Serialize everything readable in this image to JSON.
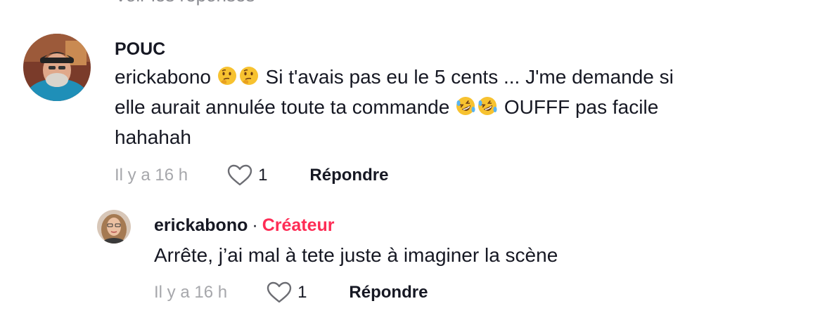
{
  "cutoff_text": "Voir les réponses",
  "comments": [
    {
      "username": "POUC",
      "text_parts": {
        "mention": "erickabono",
        "a": "Si t'avais pas eu le 5 cents ... J'me demande si",
        "b": "elle aurait annulée toute ta commande",
        "c": "OUFFF pas facile",
        "d": "hahahah"
      },
      "emojis": [
        "thinking-face",
        "thinking-face",
        "rolling-laughing-face",
        "rolling-laughing-face"
      ],
      "time": "Il y a 16 h",
      "like_count": "1",
      "reply_label": "Répondre"
    },
    {
      "username": "erickabono",
      "separator": "·",
      "badge": "Créateur",
      "text": "Arrête, j’ai mal à tete juste à imaginer la scène",
      "time": "Il y a 16 h",
      "like_count": "1",
      "reply_label": "Répondre"
    }
  ],
  "colors": {
    "creator_badge": "#fe2c55",
    "time_text": "#a6a7ab",
    "primary_text": "#161823"
  }
}
